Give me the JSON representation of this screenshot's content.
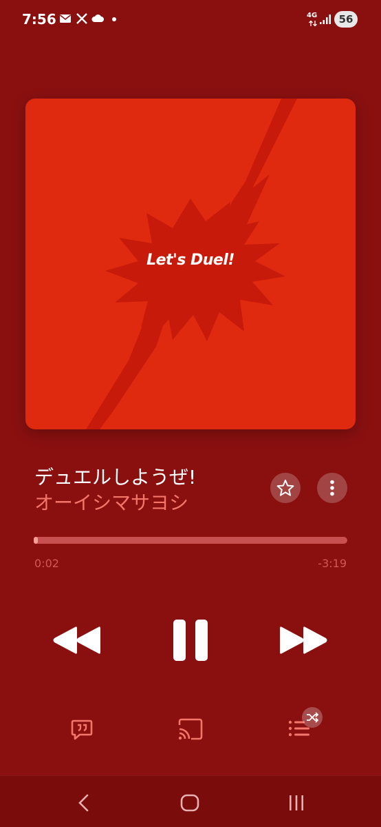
{
  "status_bar": {
    "time": "7:56",
    "network": "4G",
    "battery": "56",
    "icons": [
      "mail-icon",
      "x-icon",
      "cloud-icon",
      "dot-icon",
      "signal-icon"
    ]
  },
  "album": {
    "artwork_text": "Let's Duel!",
    "background_color": "#e02a10"
  },
  "track": {
    "title": "デュエルしようぜ!",
    "artist": "オーイシマサヨシ"
  },
  "playback": {
    "elapsed": "0:02",
    "remaining": "-3:19",
    "progress_fraction": 0.01,
    "state": "playing"
  },
  "colors": {
    "background": "#8a1010",
    "accent": "#f4766b",
    "progress_fill": "#f7a09a"
  },
  "icons": {
    "favorite": "star-icon",
    "more": "more-vertical-icon",
    "rewind": "rewind-icon",
    "pause": "pause-icon",
    "fast_forward": "fast-forward-icon",
    "lyrics": "lyrics-icon",
    "cast": "cast-icon",
    "queue": "queue-icon",
    "shuffle": "shuffle-icon",
    "nav_back": "back-icon",
    "nav_home": "home-icon",
    "nav_recents": "recents-icon"
  }
}
